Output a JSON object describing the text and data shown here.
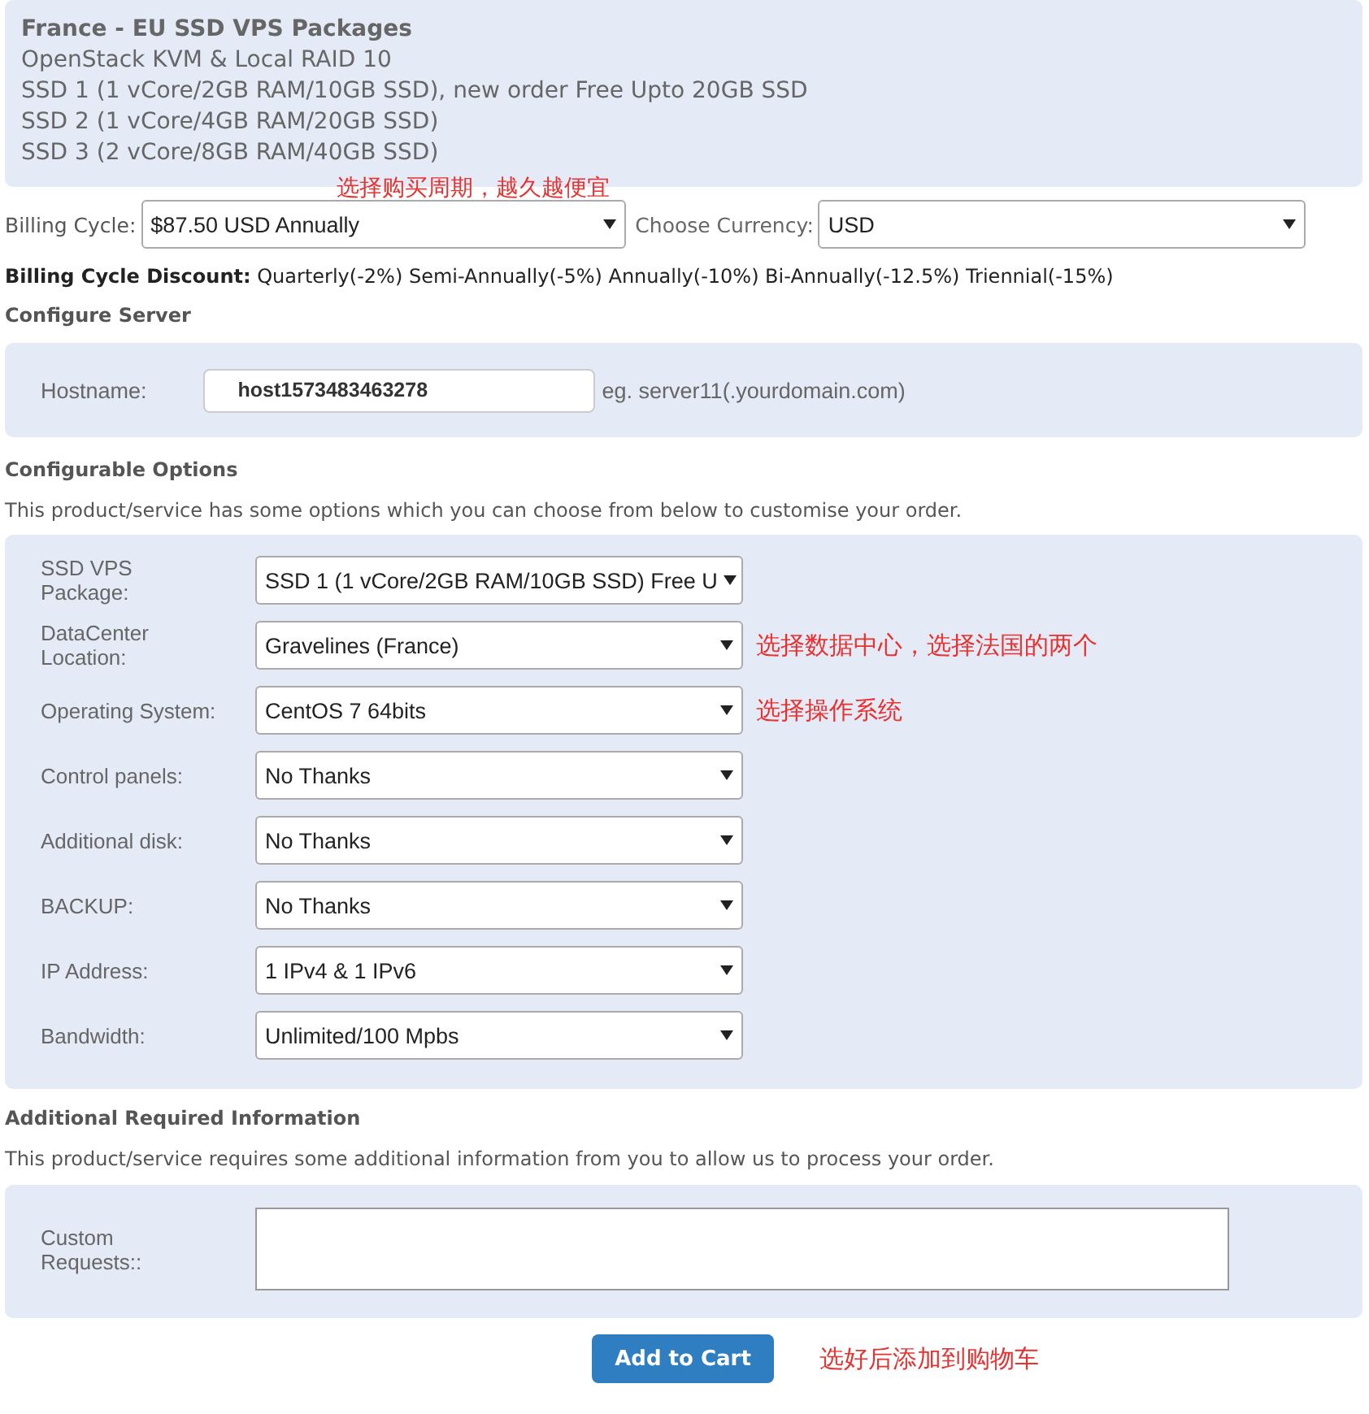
{
  "package": {
    "title": "France - EU SSD VPS Packages",
    "lines": [
      "OpenStack KVM & Local RAID 10",
      "SSD 1 (1 vCore/2GB RAM/10GB SSD), new order Free Upto 20GB SSD",
      "SSD 2 (1 vCore/4GB RAM/20GB SSD)",
      "SSD 3 (2 vCore/8GB RAM/40GB SSD)"
    ]
  },
  "billing": {
    "note": "选择购买周期，越久越便宜",
    "cycle_label": "Billing Cycle:",
    "cycle_value": "$87.50 USD Annually",
    "currency_label": "Choose Currency:",
    "currency_value": "USD"
  },
  "discount": {
    "label": "Billing Cycle Discount:",
    "text": "Quarterly(-2%) Semi-Annually(-5%) Annually(-10%) Bi-Annually(-12.5%) Triennial(-15%)"
  },
  "configure_server": {
    "heading": "Configure Server",
    "hostname_label": "Hostname:",
    "hostname_value": "host1573483463278",
    "hint": "eg. server11(.yourdomain.com)"
  },
  "configurable_options": {
    "heading": "Configurable Options",
    "description": "This product/service has some options which you can choose from below to customise your order.",
    "options": [
      {
        "label": "SSD VPS Package:",
        "value": "SSD 1 (1 vCore/2GB RAM/10GB SSD) Free U"
      },
      {
        "label": "DataCenter Location:",
        "value": "Gravelines (France)",
        "note": "选择数据中心，选择法国的两个"
      },
      {
        "label": "Operating System:",
        "value": "CentOS 7 64bits",
        "note": "选择操作系统"
      },
      {
        "label": "Control panels:",
        "value": "No Thanks"
      },
      {
        "label": "Additional disk:",
        "value": "No Thanks"
      },
      {
        "label": "BACKUP:",
        "value": "No Thanks"
      },
      {
        "label": "IP Address:",
        "value": "1 IPv4 & 1 IPv6"
      },
      {
        "label": "Bandwidth:",
        "value": "Unlimited/100 Mpbs"
      }
    ]
  },
  "additional_info": {
    "heading": "Additional Required Information",
    "description": "This product/service requires some additional information from you to allow us to process your order.",
    "custom_label": "Custom Requests::"
  },
  "add_to_cart": {
    "label": "Add to Cart",
    "note": "选好后添加到购物车"
  }
}
